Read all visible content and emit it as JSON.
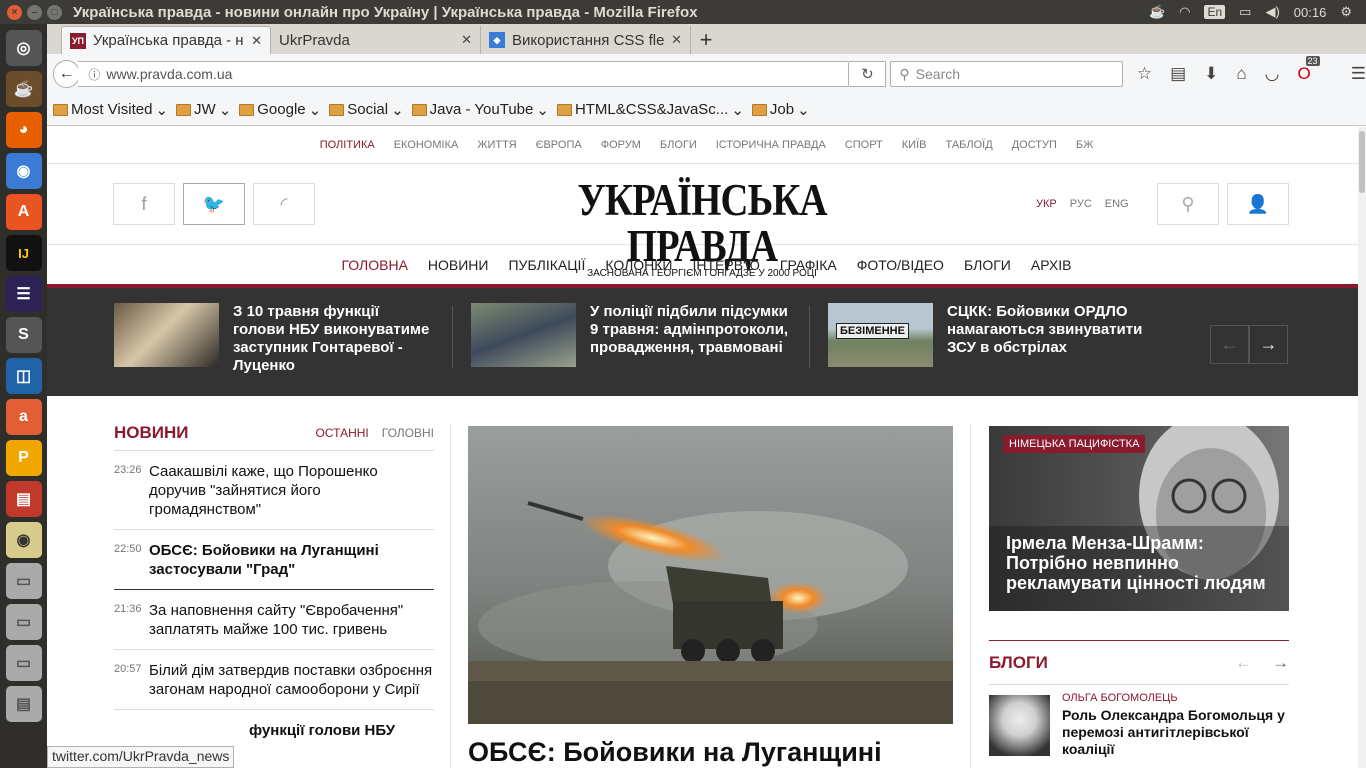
{
  "window": {
    "title": "Українська правда - новини онлайн про Україну | Українська правда - Mozilla Firefox"
  },
  "tray": {
    "lang": "En",
    "time": "00:16"
  },
  "tabs": [
    {
      "label": "Українська правда - н",
      "favicon": "УП"
    },
    {
      "label": "UkrPravda",
      "favicon": ""
    },
    {
      "label": "Використання CSS fle",
      "favicon": ""
    }
  ],
  "nav": {
    "url": "www.pravda.com.ua",
    "search_placeholder": "Search",
    "badge_count": "23"
  },
  "bookmarks": [
    "Most Visited",
    "JW",
    "Google",
    "Social",
    "Java - YouTube",
    "HTML&CSS&JavaSc...",
    "Job"
  ],
  "site": {
    "topnav": [
      "ПОЛІТИКА",
      "ЕКОНОМІКА",
      "ЖИТТЯ",
      "ЄВРОПА",
      "ФОРУМ",
      "БЛОГИ",
      "ІСТОРИЧНА ПРАВДА",
      "СПОРТ",
      "КИЇВ",
      "ТАБЛОЇД",
      "ДОСТУП",
      "БЖ"
    ],
    "logo": "УКРАЇНСЬКА ПРАВДА",
    "tagline": "ЗАСНОВАНА ГЕОРГІЄМ ГОНГАДЗЕ У 2000 РОЦІ",
    "langs": [
      "УКР",
      "РУС",
      "ENG"
    ],
    "mainnav": [
      "ГОЛОВНА",
      "НОВИНИ",
      "ПУБЛІКАЦІЇ",
      "КОЛОНКИ",
      "ІНТЕРВ'Ю",
      "ГРАФІКА",
      "ФОТО/ВІДЕО",
      "БЛОГИ",
      "АРХІВ"
    ],
    "band": [
      {
        "text": "З 10 травня функції голови НБУ виконуватиме заступник Гонтаревої - Луценко"
      },
      {
        "text": "У поліції підбили підсумки 9 травня: адмінпротоколи, провадження, травмовані"
      },
      {
        "text": "СЦКК: Бойовики ОРДЛО намагаються звинуватити ЗСУ в обстрілах"
      }
    ],
    "band_sign": "БЕЗІМЕННЕ",
    "news": {
      "title": "НОВИНИ",
      "tab_latest": "ОСТАННІ",
      "tab_main": "ГОЛОВНІ",
      "items": [
        {
          "time": "23:26",
          "text": "Саакашвілі каже, що Порошенко доручив \"зайнятися його громадянством\""
        },
        {
          "time": "22:50",
          "text": "ОБСЄ: Бойовики на Луганщині застосували \"Град\""
        },
        {
          "time": "21:36",
          "text": "За наповнення сайту \"Євробачення\" заплатять майже 100 тис. гривень"
        },
        {
          "time": "20:57",
          "text": "Білий дім затвердив поставки озброєння загонам народної самооборони у Сирії"
        },
        {
          "time": "",
          "text": "функції голови НБУ"
        }
      ]
    },
    "main_headline": "ОБСЄ: Бойовики на Луганщині",
    "feature": {
      "tag": "НІМЕЦЬКА ПАЦИФІСТКА",
      "text": "Ірмела Менза-Шрамм: Потрібно невпинно рекламувати цінності людям"
    },
    "blogs": {
      "title": "БЛОГИ",
      "author": "ОЛЬГА БОГОМОЛЕЦЬ",
      "post": "Роль Олександра Богомольця у перемозі антигітлерівської коаліції"
    }
  },
  "status_url": "twitter.com/UkrPravda_news"
}
